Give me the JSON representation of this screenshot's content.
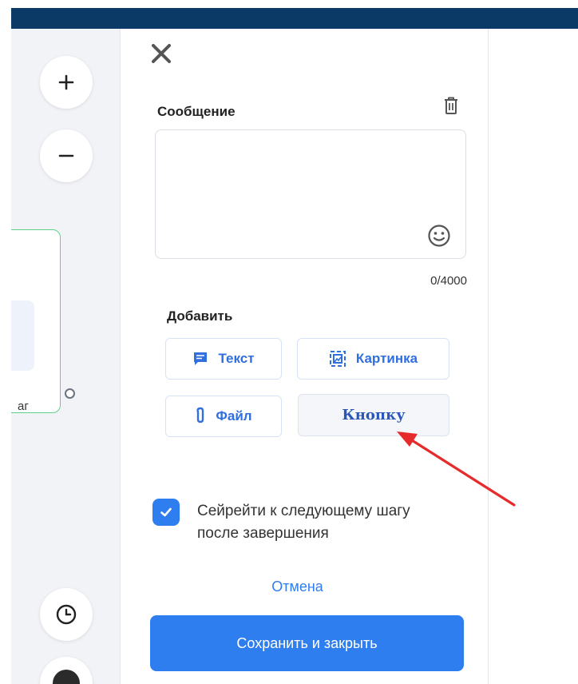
{
  "editor": {
    "title": "Сообщение",
    "counter": "0/4000",
    "add_label": "Добавить",
    "buttons": {
      "text": "Текст",
      "image": "Картинка",
      "file": "Файл",
      "button": "Кнопку"
    },
    "checkbox_label": "Сейрейти к следующему шагу после завершения",
    "checkbox_checked": true,
    "cancel": "Отмена",
    "save": "Сохранить и закрыть"
  },
  "canvas": {
    "node_label": "аг"
  },
  "icons": {
    "close": "close-icon",
    "trash": "trash-icon",
    "emoji": "emoji-icon",
    "text": "chat-bubble-icon",
    "image": "image-icon",
    "file": "paperclip-icon",
    "zoom_in": "plus-icon",
    "zoom_out": "minus-icon",
    "history": "clock-icon"
  },
  "colors": {
    "topbar": "#0b3a66",
    "accent": "#2f7ef0",
    "node_border": "#5fd08a",
    "annotation_arrow": "#e52b2b"
  }
}
